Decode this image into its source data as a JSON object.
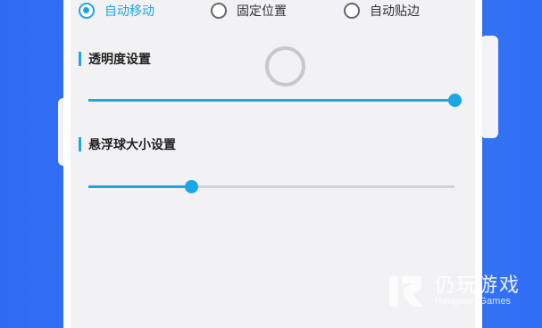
{
  "position_modes": [
    {
      "label": "自动移动",
      "checked": true
    },
    {
      "label": "固定位置",
      "checked": false
    },
    {
      "label": "自动贴边",
      "checked": false
    }
  ],
  "opacity": {
    "title": "透明度设置",
    "value": 1.0
  },
  "ball_size": {
    "title": "悬浮球大小设置",
    "value": 0.28
  },
  "watermark": {
    "cn": "仍玩游戏",
    "en": "Rengwan Games"
  },
  "colors": {
    "accent": "#1aa7e8",
    "background": "#3a78f6",
    "panel": "#f2f2f4"
  },
  "icons": {
    "radio_checked": "radio-checked-icon",
    "radio_unchecked": "radio-unchecked-icon",
    "float_ball": "float-ball-icon",
    "watermark_logo": "rengwan-logo-icon"
  }
}
